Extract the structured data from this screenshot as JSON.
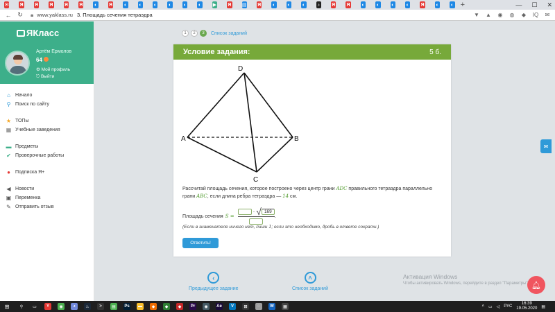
{
  "browser": {
    "tabs": [
      {
        "icon": "mail-icon",
        "color": "#e53935",
        "glyph": "✉"
      },
      {
        "icon": "yandex-icon",
        "color": "#e53935",
        "glyph": "Я"
      },
      {
        "icon": "yandex-icon",
        "color": "#e53935",
        "glyph": "Я"
      },
      {
        "icon": "yandex-icon",
        "color": "#e53935",
        "glyph": "Я"
      },
      {
        "icon": "yandex-icon",
        "color": "#e53935",
        "glyph": "Я"
      },
      {
        "icon": "yandex-icon",
        "color": "#e53935",
        "glyph": "Я"
      },
      {
        "icon": "yaklass-icon",
        "color": "#1e88e5",
        "glyph": "◐"
      },
      {
        "icon": "yandex-icon",
        "color": "#e53935",
        "glyph": "Я"
      },
      {
        "icon": "yaklass-icon",
        "color": "#1e88e5",
        "glyph": "◐"
      },
      {
        "icon": "yaklass-icon",
        "color": "#1e88e5",
        "glyph": "◐"
      },
      {
        "icon": "yaklass-icon",
        "color": "#1e88e5",
        "glyph": "◐"
      },
      {
        "icon": "yaklass-icon",
        "color": "#1e88e5",
        "glyph": "◐"
      },
      {
        "icon": "yaklass-icon",
        "color": "#1e88e5",
        "glyph": "◐"
      },
      {
        "icon": "yaklass-icon",
        "color": "#1e88e5",
        "glyph": "◐"
      },
      {
        "icon": "yaklass-icon",
        "color": "#3daf8a",
        "glyph": "▶"
      },
      {
        "icon": "yandex-icon",
        "color": "#e53935",
        "glyph": "Я"
      },
      {
        "icon": "doc-icon",
        "color": "#1e88e5",
        "glyph": "▤"
      },
      {
        "icon": "yandex-icon",
        "color": "#e53935",
        "glyph": "Я"
      },
      {
        "icon": "yaklass-icon",
        "color": "#1e88e5",
        "glyph": "◐"
      },
      {
        "icon": "yaklass-icon",
        "color": "#1e88e5",
        "glyph": "◐"
      },
      {
        "icon": "yaklass-icon",
        "color": "#1e88e5",
        "glyph": "◐"
      },
      {
        "icon": "tiktok-icon",
        "color": "#222222",
        "glyph": "♪"
      },
      {
        "icon": "yandex-icon",
        "color": "#e53935",
        "glyph": "Я"
      },
      {
        "icon": "yandex-icon",
        "color": "#e53935",
        "glyph": "Я"
      },
      {
        "icon": "yaklass-icon",
        "color": "#1e88e5",
        "glyph": "◐"
      },
      {
        "icon": "yaklass-icon",
        "color": "#1e88e5",
        "glyph": "◐"
      },
      {
        "icon": "yaklass-icon",
        "color": "#1e88e5",
        "glyph": "◐"
      },
      {
        "icon": "yaklass-icon",
        "color": "#1e88e5",
        "glyph": "◐"
      },
      {
        "icon": "yandex-icon",
        "color": "#e53935",
        "glyph": "Я"
      },
      {
        "icon": "yaklass-icon",
        "color": "#1e88e5",
        "glyph": "◐"
      },
      {
        "icon": "yaklass-icon",
        "color": "#1e88e5",
        "glyph": "◐"
      }
    ],
    "new_tab": "+",
    "window_controls": {
      "minimize": "—",
      "maximize": "☐",
      "close": "✕"
    },
    "url": "www.yaklass.ru",
    "page_title": "3. Площадь сечения тетраэдра",
    "extensions": [
      "▼",
      "▲",
      "◉",
      "◍",
      "◆",
      "IQ",
      "✉"
    ]
  },
  "sidebar": {
    "logo": "ЯКласс",
    "user_name": "Артём Ермолов",
    "points": "64",
    "profile_link": "Мой профиль",
    "logout_link": "Выйти",
    "menu": [
      {
        "label": "Начало",
        "icon": "home-icon",
        "glyph": "⌂",
        "color": "#2f9ad8"
      },
      {
        "label": "Поиск по сайту",
        "icon": "search-icon",
        "glyph": "⚲",
        "color": "#2f9ad8"
      },
      {
        "label": "ТОПы",
        "icon": "star-icon",
        "glyph": "★",
        "color": "#f5a623"
      },
      {
        "label": "Учебные заведения",
        "icon": "school-icon",
        "glyph": "▦",
        "color": "#777777"
      },
      {
        "label": "Предметы",
        "icon": "subjects-icon",
        "glyph": "▬",
        "color": "#3daf8a"
      },
      {
        "label": "Проверочные работы",
        "icon": "check-icon",
        "glyph": "✔",
        "color": "#3daf8a"
      },
      {
        "label": "Подписка Я+",
        "icon": "subscription-icon",
        "glyph": "●",
        "color": "#e53935"
      },
      {
        "label": "Новости",
        "icon": "news-icon",
        "glyph": "◀",
        "color": "#555555"
      },
      {
        "label": "Переменка",
        "icon": "break-icon",
        "glyph": "▣",
        "color": "#555555"
      },
      {
        "label": "Отправить отзыв",
        "icon": "feedback-icon",
        "glyph": "✎",
        "color": "#555555"
      }
    ]
  },
  "steps": {
    "items": [
      "1",
      "2",
      "3"
    ],
    "active_index": 2,
    "link": "Список заданий"
  },
  "task": {
    "title": "Условие задания:",
    "score": "5 б.",
    "figure_labels": {
      "a": "A",
      "b": "B",
      "c": "C",
      "d": "D"
    },
    "text_1": "Рассчитай площадь сечения, которое построено через центр грани ",
    "face_1": "ADC",
    "text_2": " правильного тетраэдра параллельно грани ",
    "face_2": "ABC",
    "text_3": ", если длина ребра тетраэдра — ",
    "edge": "14",
    "text_4": " см.",
    "answer_label": "Площадь сечения",
    "answer_var": "S =",
    "sqrt_value": "169",
    "answer_end": ".",
    "hint_1": "(Если в знаменателе ничего нет, пиши ",
    "hint_num": "1",
    "hint_2": "; если это необходимо, дробь в ответе сократи.)",
    "submit": "Ответить!"
  },
  "bottom_nav": {
    "prev": "Предыдущее задание",
    "list": "Список заданий"
  },
  "watermark": {
    "title": "Активация Windows",
    "subtitle": "Чтобы активировать Windows, перейдите в раздел \"Параметры\"."
  },
  "taskbar": {
    "icons": [
      {
        "icon": "search-icon",
        "color": "#1f1f1f",
        "glyph": "⚲"
      },
      {
        "icon": "task-view-icon",
        "color": "#1f1f1f",
        "glyph": "▭"
      },
      {
        "icon": "yandex-browser-icon",
        "color": "#e53935",
        "glyph": "Y"
      },
      {
        "icon": "chrome-icon",
        "color": "#4caf50",
        "glyph": "◉"
      },
      {
        "icon": "discord-icon",
        "color": "#7289da",
        "glyph": "◕"
      },
      {
        "icon": "steam-icon",
        "color": "#1b2838",
        "glyph": "♨"
      },
      {
        "icon": "terminal-icon",
        "color": "#333333",
        "glyph": ">"
      },
      {
        "icon": "notepad-icon",
        "color": "#4caf50",
        "glyph": "▤"
      },
      {
        "icon": "photoshop-icon",
        "color": "#001e36",
        "glyph": "Ps"
      },
      {
        "icon": "folder-icon",
        "color": "#fbc02d",
        "glyph": "▬"
      },
      {
        "icon": "app-icon",
        "color": "#ef6c00",
        "glyph": "◆"
      },
      {
        "icon": "app-icon",
        "color": "#2e7d32",
        "glyph": "◆"
      },
      {
        "icon": "app-icon",
        "color": "#c62828",
        "glyph": "◆"
      },
      {
        "icon": "premiere-icon",
        "color": "#2a0a4a",
        "glyph": "Pr"
      },
      {
        "icon": "app-icon",
        "color": "#455a64",
        "glyph": "◉"
      },
      {
        "icon": "after-effects-icon",
        "color": "#1a0a3a",
        "glyph": "Ae"
      },
      {
        "icon": "vscode-icon",
        "color": "#0277bd",
        "glyph": "V"
      },
      {
        "icon": "app-icon",
        "color": "#333333",
        "glyph": "⊞"
      },
      {
        "icon": "app-icon",
        "color": "#9e9e9e",
        "glyph": "◌"
      },
      {
        "icon": "word-icon",
        "color": "#1565c0",
        "glyph": "W"
      },
      {
        "icon": "calculator-icon",
        "color": "#444444",
        "glyph": "▦"
      }
    ],
    "lang": "РУС",
    "time": "16:39",
    "date": "19.05.2020"
  }
}
